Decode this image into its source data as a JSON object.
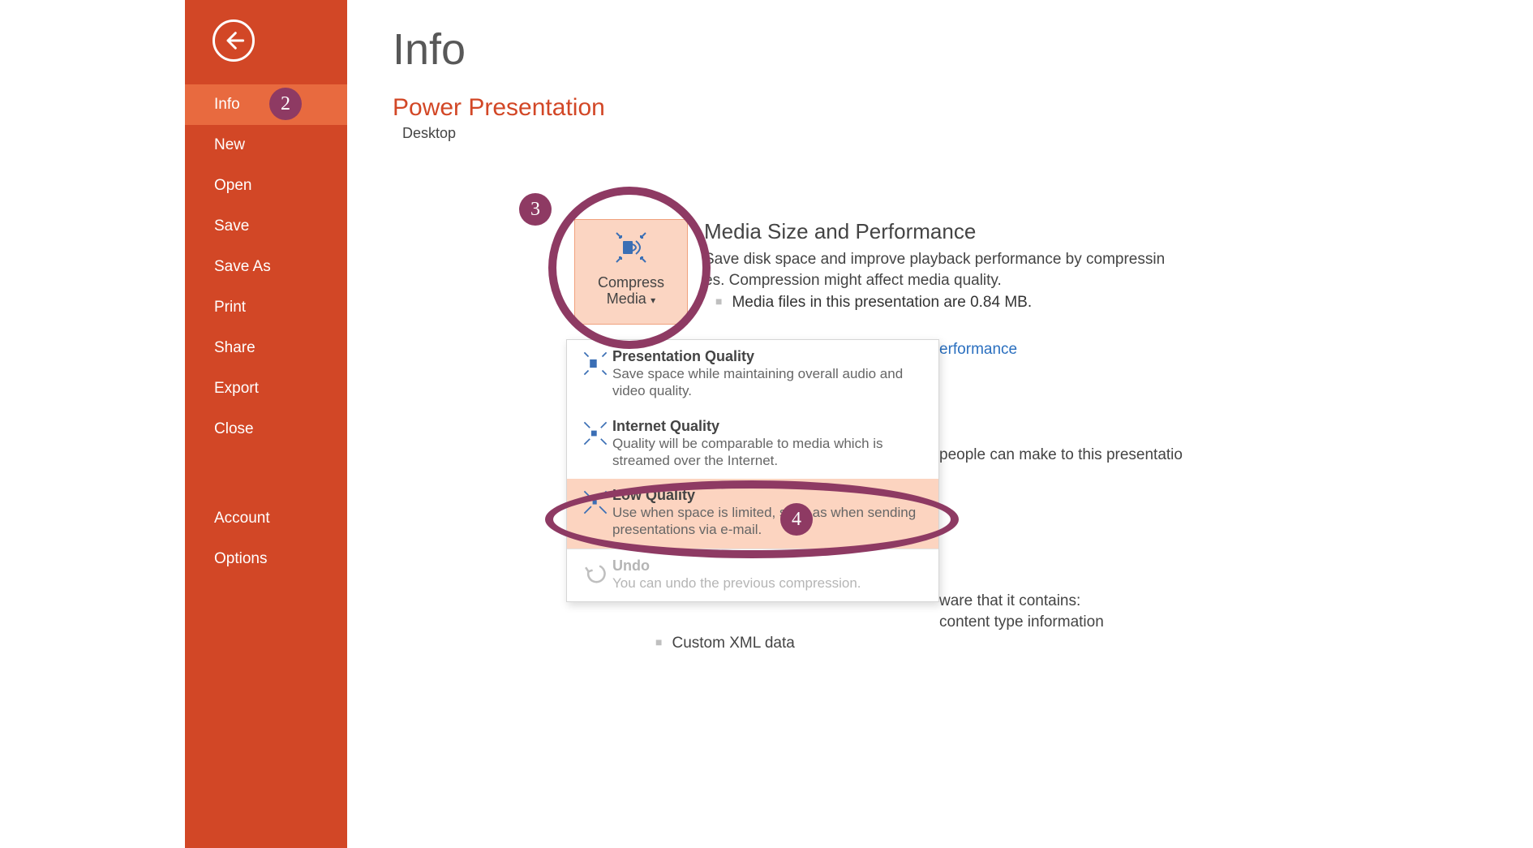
{
  "sidebar": {
    "items": [
      {
        "label": "Info",
        "active": true
      },
      {
        "label": "New"
      },
      {
        "label": "Open"
      },
      {
        "label": "Save"
      },
      {
        "label": "Save As"
      },
      {
        "label": "Print"
      },
      {
        "label": "Share"
      },
      {
        "label": "Export"
      },
      {
        "label": "Close"
      }
    ],
    "bottom_items": [
      {
        "label": "Account"
      },
      {
        "label": "Options"
      }
    ]
  },
  "page": {
    "title": "Info",
    "file_name": "Power Presentation",
    "file_path_visible": "Desktop"
  },
  "compress_button": {
    "line1": "Compress",
    "line2": "Media"
  },
  "media_section": {
    "heading": "Media Size and Performance",
    "desc_line1": "Save disk space and improve playback performance by compressin",
    "desc_line2": "es. Compression might affect media quality.",
    "bullet": "Media files in this presentation are 0.84 MB.",
    "link_fragment": "erformance"
  },
  "dropdown": {
    "items": [
      {
        "title": "Presentation Quality",
        "desc": "Save space while maintaining overall audio and video quality."
      },
      {
        "title": "Internet Quality",
        "desc": "Quality will be comparable to media which is streamed over the Internet."
      },
      {
        "title": "Low Quality",
        "desc": "Use when space is limited, such as when sending presentations via e-mail."
      },
      {
        "title": "Undo",
        "desc": "You can undo the previous compression."
      }
    ]
  },
  "fragments": {
    "frag2": "people can make to this presentatio",
    "frag3": "ware that it contains:",
    "frag4": "content type information",
    "bullet2": "Custom XML data"
  },
  "annotations": {
    "b2": "2",
    "b3": "3",
    "b4": "4"
  }
}
